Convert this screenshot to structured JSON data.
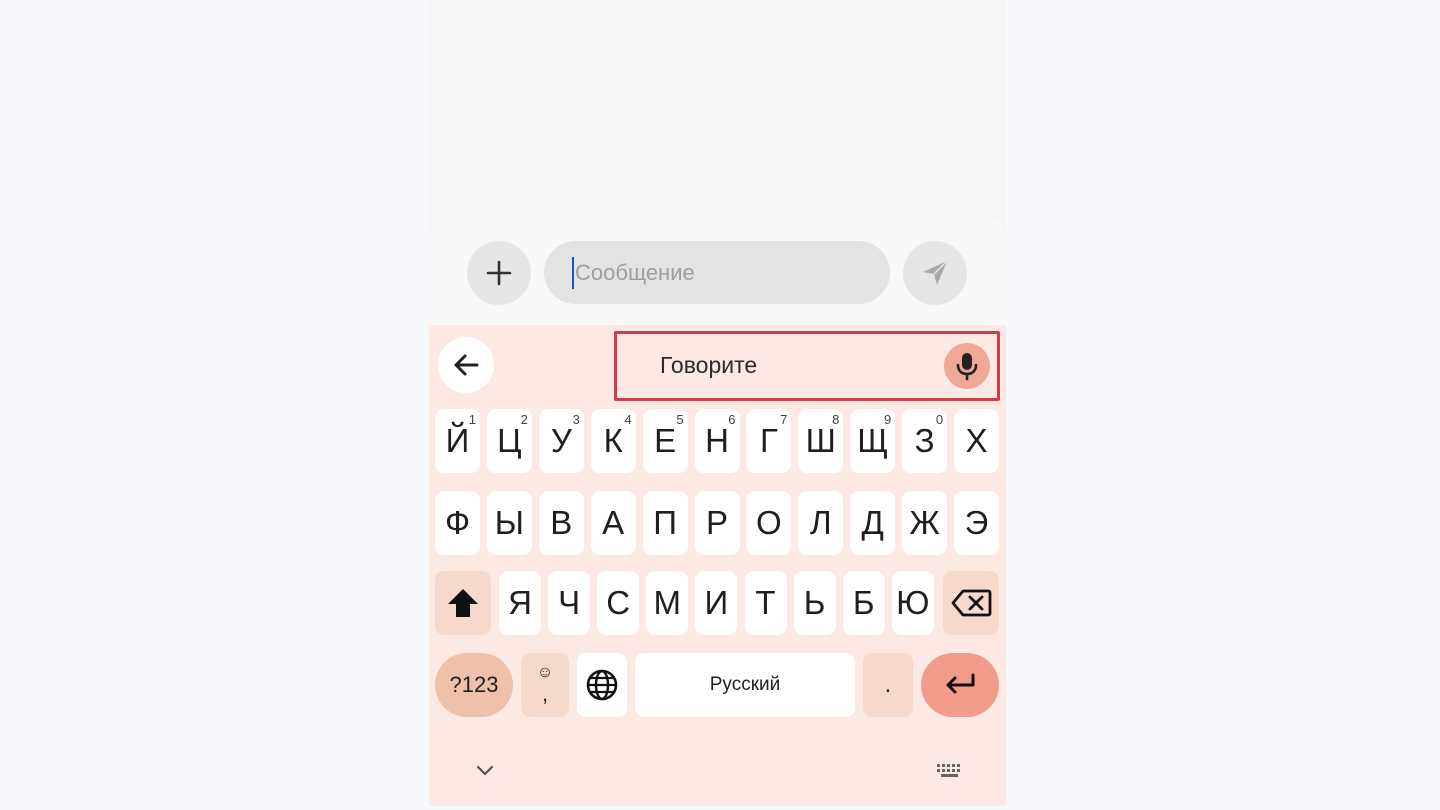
{
  "composer": {
    "add_label": "+",
    "message_placeholder": "Сообщение",
    "message_value": ""
  },
  "voice": {
    "status_text": "Говорите"
  },
  "keyboard": {
    "row1": [
      {
        "label": "Й",
        "hint": "1"
      },
      {
        "label": "Ц",
        "hint": "2"
      },
      {
        "label": "У",
        "hint": "3"
      },
      {
        "label": "К",
        "hint": "4"
      },
      {
        "label": "Е",
        "hint": "5"
      },
      {
        "label": "Н",
        "hint": "6"
      },
      {
        "label": "Г",
        "hint": "7"
      },
      {
        "label": "Ш",
        "hint": "8"
      },
      {
        "label": "Щ",
        "hint": "9"
      },
      {
        "label": "З",
        "hint": "0"
      },
      {
        "label": "Х",
        "hint": ""
      }
    ],
    "row2": [
      "Ф",
      "Ы",
      "В",
      "А",
      "П",
      "Р",
      "О",
      "Л",
      "Д",
      "Ж",
      "Э"
    ],
    "row3": [
      "Я",
      "Ч",
      "С",
      "М",
      "И",
      "Т",
      "Ь",
      "Б",
      "Ю"
    ],
    "symbols_label": "?123",
    "emoji_top": "☺",
    "emoji_bottom": ",",
    "space_label": "Русский",
    "period_label": "."
  },
  "colors": {
    "keyboard_bg": "#fde9e4",
    "accent_enter": "#f29b8a",
    "highlight_border": "#d63a46"
  },
  "icons": [
    "plus-icon",
    "send-icon",
    "back-arrow-icon",
    "mic-icon",
    "shift-icon",
    "backspace-icon",
    "globe-icon",
    "enter-icon",
    "chevron-down-icon",
    "keyboard-icon"
  ]
}
